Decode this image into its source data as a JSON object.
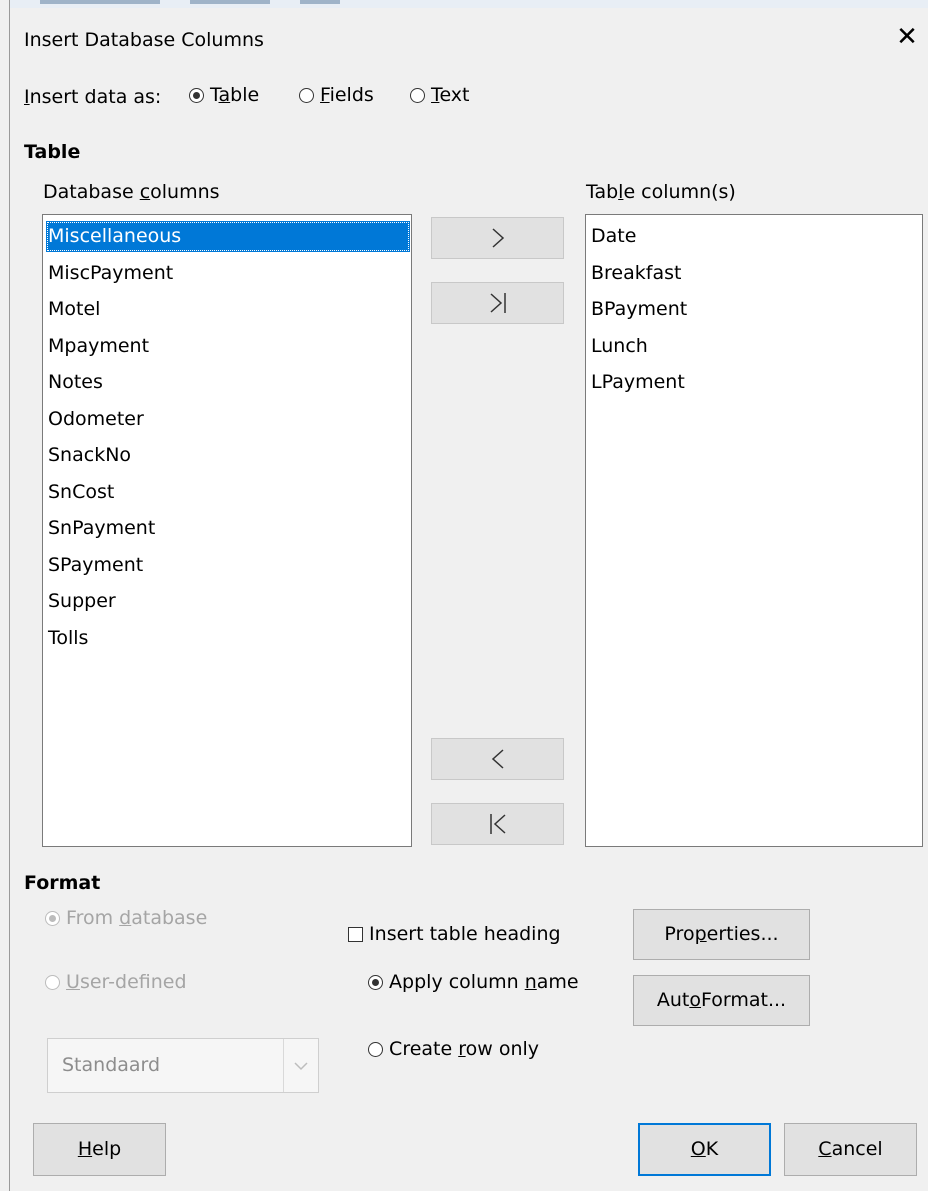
{
  "window": {
    "title": "Insert Database Columns"
  },
  "insert_as": {
    "label_pre": "",
    "label_u": "I",
    "label_post": "nsert data as:",
    "options": [
      {
        "pre": "T",
        "u": "a",
        "post": "ble",
        "checked": true
      },
      {
        "pre": "",
        "u": "F",
        "post": "ields",
        "checked": false
      },
      {
        "pre": "",
        "u": "T",
        "post": "ext",
        "checked": false
      }
    ]
  },
  "table_section": {
    "heading": "Table",
    "db_columns_label": {
      "pre": "Database ",
      "u": "c",
      "post": "olumns"
    },
    "table_columns_label": {
      "pre": "Tab",
      "u": "l",
      "post": "e column(s)"
    },
    "database_columns": [
      "Miscellaneous",
      "MiscPayment",
      "Motel",
      "Mpayment",
      "Notes",
      "Odometer",
      "SnackNo",
      "SnCost",
      "SnPayment",
      "SPayment",
      "Supper",
      "Tolls"
    ],
    "selected_index": 0,
    "table_columns": [
      "Date",
      "Breakfast",
      "BPayment",
      "Lunch",
      "LPayment"
    ],
    "arrow_icons": [
      "chevron-right-icon",
      "chevron-right-bar-icon",
      "chevron-left-icon",
      "chevron-left-bar-icon"
    ]
  },
  "format": {
    "heading": "Format",
    "from_database": {
      "pre": "From ",
      "u": "d",
      "post": "atabase"
    },
    "user_defined": {
      "pre": "",
      "u": "U",
      "post": "ser-defined"
    },
    "combo_value": "Standaard",
    "insert_heading": {
      "pre": "Insert table heading",
      "u": "",
      "post": ""
    },
    "apply_column_name": {
      "pre": "Apply column ",
      "u": "n",
      "post": "ame"
    },
    "create_row_only": {
      "pre": "Create ",
      "u": "r",
      "post": "ow only"
    },
    "properties": {
      "pre": "Pro",
      "u": "p",
      "post": "erties..."
    },
    "autoformat": {
      "pre": "Aut",
      "u": "o",
      "post": "Format..."
    }
  },
  "footer": {
    "help": {
      "pre": "",
      "u": "H",
      "post": "elp"
    },
    "ok": {
      "pre": "",
      "u": "O",
      "post": "K"
    },
    "cancel": {
      "pre": "",
      "u": "C",
      "post": "ancel"
    }
  }
}
